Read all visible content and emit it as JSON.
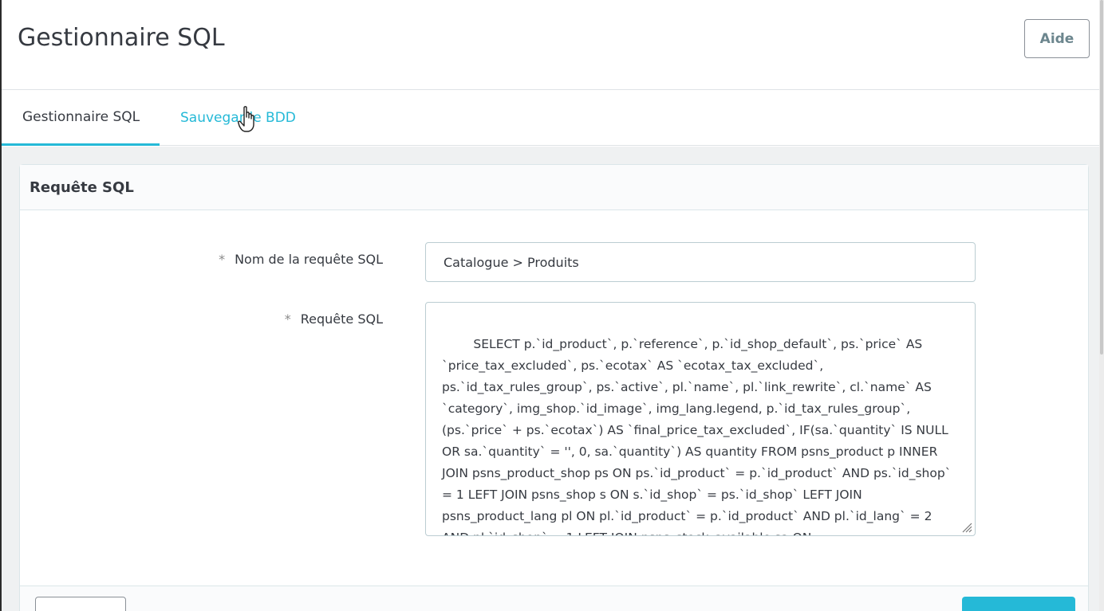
{
  "header": {
    "title": "Gestionnaire SQL",
    "help_label": "Aide"
  },
  "tabs": [
    {
      "label": "Gestionnaire SQL",
      "active": true
    },
    {
      "label": "Sauvegarde BDD",
      "active": false
    }
  ],
  "card": {
    "title": "Requête SQL",
    "fields": {
      "name": {
        "label": "Nom de la requête SQL",
        "required_marker": "*",
        "value": "Catalogue > Produits"
      },
      "query": {
        "label": "Requête SQL",
        "required_marker": "*",
        "value": "SELECT p.`id_product`, p.`reference`, p.`id_shop_default`, ps.`price` AS `price_tax_excluded`, ps.`ecotax` AS `ecotax_tax_excluded`, ps.`id_tax_rules_group`, ps.`active`, pl.`name`, pl.`link_rewrite`, cl.`name` AS `category`, img_shop.`id_image`, img_lang.legend, p.`id_tax_rules_group`, (ps.`price` + ps.`ecotax`) AS `final_price_tax_excluded`, IF(sa.`quantity` IS NULL OR sa.`quantity` = '', 0, sa.`quantity`) AS quantity FROM psns_product p INNER JOIN psns_product_shop ps ON ps.`id_product` = p.`id_product` AND ps.`id_shop` = 1 LEFT JOIN psns_shop s ON s.`id_shop` = ps.`id_shop` LEFT JOIN psns_product_lang pl ON pl.`id_product` = p.`id_product` AND pl.`id_lang` = 2 AND pl.`id_shop` = 1 LEFT JOIN psns_stock_available sa ON"
      }
    }
  },
  "colors": {
    "accent": "#25b9d7",
    "text": "#363a41",
    "background": "#eff1f2"
  }
}
